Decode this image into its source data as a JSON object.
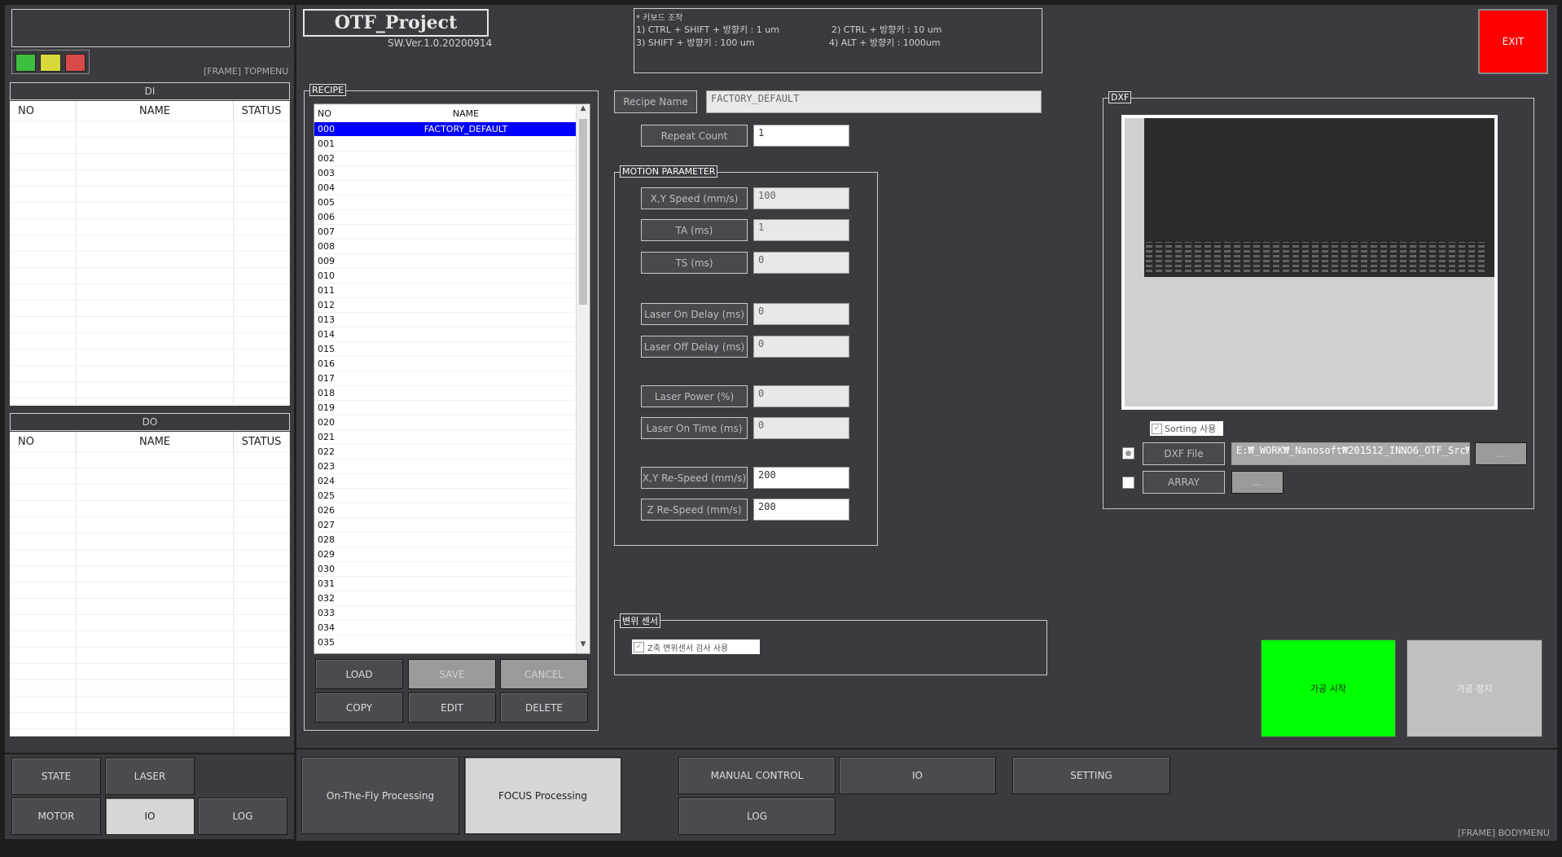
{
  "top": {
    "title": "OTF_Project",
    "version": "SW.Ver.1.0.20200914",
    "frame_topmenu": "[FRAME] TOPMENU",
    "keyboard_title": "* 키보드 조작",
    "keys": [
      "1) CTRL + SHIFT + 방향키 : 1 um",
      "2) CTRL + 방향키 : 10 um",
      "3) SHIFT + 방향키 : 100 um",
      "4) ALT + 방향키 : 1000um"
    ],
    "exit_label": "EXIT",
    "lights": [
      "#3fbf3f",
      "#d8d83a",
      "#d84a4a"
    ]
  },
  "di": {
    "title": "DI",
    "columns": [
      "NO",
      "NAME",
      "STATUS"
    ]
  },
  "do": {
    "title": "DO",
    "columns": [
      "NO",
      "NAME",
      "STATUS"
    ]
  },
  "recipe": {
    "group_title": "RECIPE",
    "columns": [
      "NO",
      "NAME"
    ],
    "rows": [
      {
        "no": "000",
        "name": "FACTORY_DEFAULT"
      },
      {
        "no": "001",
        "name": ""
      },
      {
        "no": "002",
        "name": ""
      },
      {
        "no": "003",
        "name": ""
      },
      {
        "no": "004",
        "name": ""
      },
      {
        "no": "005",
        "name": ""
      },
      {
        "no": "006",
        "name": ""
      },
      {
        "no": "007",
        "name": ""
      },
      {
        "no": "008",
        "name": ""
      },
      {
        "no": "009",
        "name": ""
      },
      {
        "no": "010",
        "name": ""
      },
      {
        "no": "011",
        "name": ""
      },
      {
        "no": "012",
        "name": ""
      },
      {
        "no": "013",
        "name": ""
      },
      {
        "no": "014",
        "name": ""
      },
      {
        "no": "015",
        "name": ""
      },
      {
        "no": "016",
        "name": ""
      },
      {
        "no": "017",
        "name": ""
      },
      {
        "no": "018",
        "name": ""
      },
      {
        "no": "019",
        "name": ""
      },
      {
        "no": "020",
        "name": ""
      },
      {
        "no": "021",
        "name": ""
      },
      {
        "no": "022",
        "name": ""
      },
      {
        "no": "023",
        "name": ""
      },
      {
        "no": "024",
        "name": ""
      },
      {
        "no": "025",
        "name": ""
      },
      {
        "no": "026",
        "name": ""
      },
      {
        "no": "027",
        "name": ""
      },
      {
        "no": "028",
        "name": ""
      },
      {
        "no": "029",
        "name": ""
      },
      {
        "no": "030",
        "name": ""
      },
      {
        "no": "031",
        "name": ""
      },
      {
        "no": "032",
        "name": ""
      },
      {
        "no": "033",
        "name": ""
      },
      {
        "no": "034",
        "name": ""
      },
      {
        "no": "035",
        "name": ""
      }
    ],
    "buttons": {
      "load": "LOAD",
      "save": "SAVE",
      "cancel": "CANCEL",
      "copy": "COPY",
      "edit": "EDIT",
      "delete": "DELETE"
    }
  },
  "params": {
    "recipe_name_label": "Recipe Name",
    "recipe_name_value": "FACTORY_DEFAULT",
    "repeat_label": "Repeat Count",
    "repeat_value": "1",
    "motion_title": "MOTION PARAMETER",
    "items": [
      {
        "label": "X,Y Speed (mm/s)",
        "value": "100"
      },
      {
        "label": "TA (ms)",
        "value": "1"
      },
      {
        "label": "TS (ms)",
        "value": "0"
      },
      {
        "label": "Laser On Delay (ms)",
        "value": "0"
      },
      {
        "label": "Laser Off Delay (ms)",
        "value": "0"
      },
      {
        "label": "Laser Power (%)",
        "value": "0"
      },
      {
        "label": "Laser On Time (ms)",
        "value": "0"
      },
      {
        "label": "X,Y Re-Speed (mm/s)",
        "value": "200"
      },
      {
        "label": "Z Re-Speed (mm/s)",
        "value": "200"
      }
    ],
    "sensor_title": "변위 센서",
    "sensor_check": "Z축 변위센서 검사 사용"
  },
  "dxf": {
    "group_title": "DXF",
    "sorting_label": "Sorting 사용",
    "dxf_file_label": "DXF File",
    "dxf_file_path": "E:₩_WORK₩_Nanosoft₩201512_INNO6_OTF_Src₩",
    "array_label": "ARRAY",
    "browse": "...",
    "start_label": "가공 시작",
    "stop_label": "가공 정지"
  },
  "bottom_left": {
    "state": "STATE",
    "laser": "LASER",
    "motor": "MOTOR",
    "io": "IO",
    "log": "LOG"
  },
  "bottom": {
    "otf": "On-The-Fly Processing",
    "focus": "FOCUS Processing",
    "manual": "MANUAL CONTROL",
    "io": "IO",
    "setting": "SETTING",
    "log": "LOG",
    "frame_body": "[FRAME] BODYMENU"
  }
}
